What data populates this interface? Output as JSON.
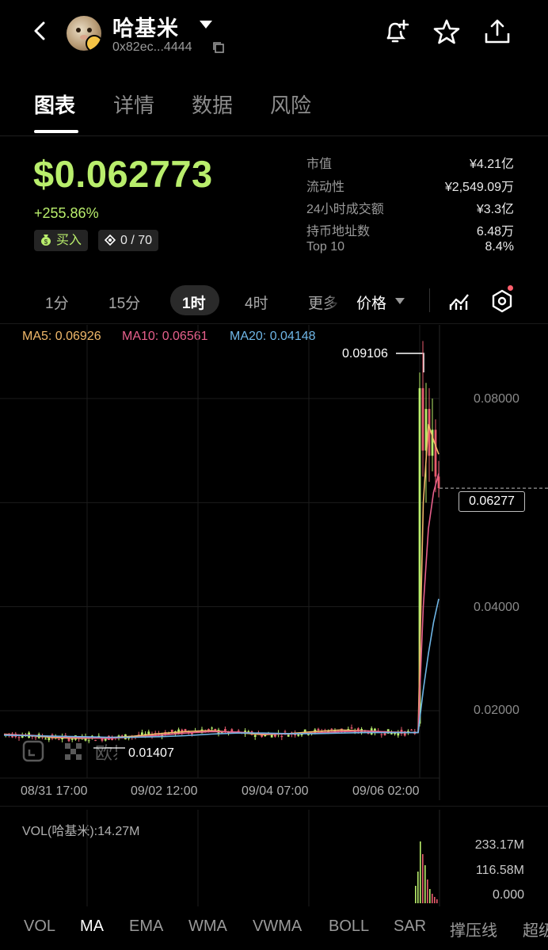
{
  "header": {
    "token_name": "哈基米",
    "address": "0x82ec...4444"
  },
  "tabs": [
    {
      "label": "图表"
    },
    {
      "label": "详情"
    },
    {
      "label": "数据"
    },
    {
      "label": "风险"
    }
  ],
  "price": {
    "value": "$0.062773",
    "change": "+255.86%",
    "buy_label": "买入",
    "holder_ratio": "0 / 70"
  },
  "stats": [
    {
      "label": "市值",
      "value": "¥4.21亿"
    },
    {
      "label": "流动性",
      "value": "¥2,549.09万"
    },
    {
      "label": "24小时成交额",
      "value": "¥3.3亿"
    },
    {
      "label": "持币地址数",
      "value": "6.48万"
    },
    {
      "label": "Top 10",
      "value": "8.4%"
    }
  ],
  "intervals": [
    {
      "label": "1分"
    },
    {
      "label": "15分"
    },
    {
      "label": "1时"
    },
    {
      "label": "4时"
    },
    {
      "label": "更多"
    }
  ],
  "price_dropdown": "价格",
  "ma_legend": {
    "ma5": "MA5: 0.06926",
    "ma10": "MA10: 0.06561",
    "ma20": "MA20: 0.04148"
  },
  "colors": {
    "accent_green": "#b9ee6c",
    "ma5": "#f0b86a",
    "ma10": "#e7608c",
    "ma20": "#6fb6e6",
    "down_red": "#e85c6e"
  },
  "watermark": "欧易",
  "chart_data": {
    "type": "line",
    "x_ticks": [
      "08/31 17:00",
      "09/02 12:00",
      "09/04 07:00",
      "09/06 02:00"
    ],
    "y_ticks": [
      "0.08000",
      "0.04000",
      "0.02000"
    ],
    "y_range": [
      0.012,
      0.1
    ],
    "high_label": "0.09106",
    "low_label": "0.01407",
    "current_price_label": "0.06277",
    "series": [
      {
        "name": "MA5",
        "values": [
          0.0155,
          0.0152,
          0.0148,
          0.0147,
          0.0148,
          0.0151,
          0.0156,
          0.016,
          0.0162,
          0.0158,
          0.0154,
          0.0156,
          0.016,
          0.0163,
          0.0161,
          0.0158,
          0.0158,
          0.06,
          0.075,
          0.072,
          0.0693
        ]
      },
      {
        "name": "MA10",
        "values": [
          0.0154,
          0.0153,
          0.015,
          0.0148,
          0.0147,
          0.0149,
          0.0153,
          0.0157,
          0.016,
          0.0159,
          0.0156,
          0.0155,
          0.0157,
          0.016,
          0.0161,
          0.0159,
          0.0158,
          0.04,
          0.055,
          0.062,
          0.0656
        ]
      },
      {
        "name": "MA20",
        "values": [
          0.0153,
          0.0152,
          0.0151,
          0.015,
          0.0149,
          0.0149,
          0.015,
          0.0152,
          0.0155,
          0.0157,
          0.0157,
          0.0156,
          0.0156,
          0.0157,
          0.0158,
          0.0158,
          0.0158,
          0.024,
          0.031,
          0.037,
          0.0415
        ]
      }
    ],
    "volume": {
      "label": "VOL(哈基米):14.27M",
      "y_ticks": [
        "233.17M",
        "116.58M",
        "0.000"
      ]
    }
  },
  "indicators": [
    {
      "label": "VOL"
    },
    {
      "label": "MA"
    },
    {
      "label": "EMA"
    },
    {
      "label": "WMA"
    },
    {
      "label": "VWMA"
    },
    {
      "label": "BOLL"
    },
    {
      "label": "SAR"
    },
    {
      "label": "撑压线"
    },
    {
      "label": "超级"
    }
  ]
}
